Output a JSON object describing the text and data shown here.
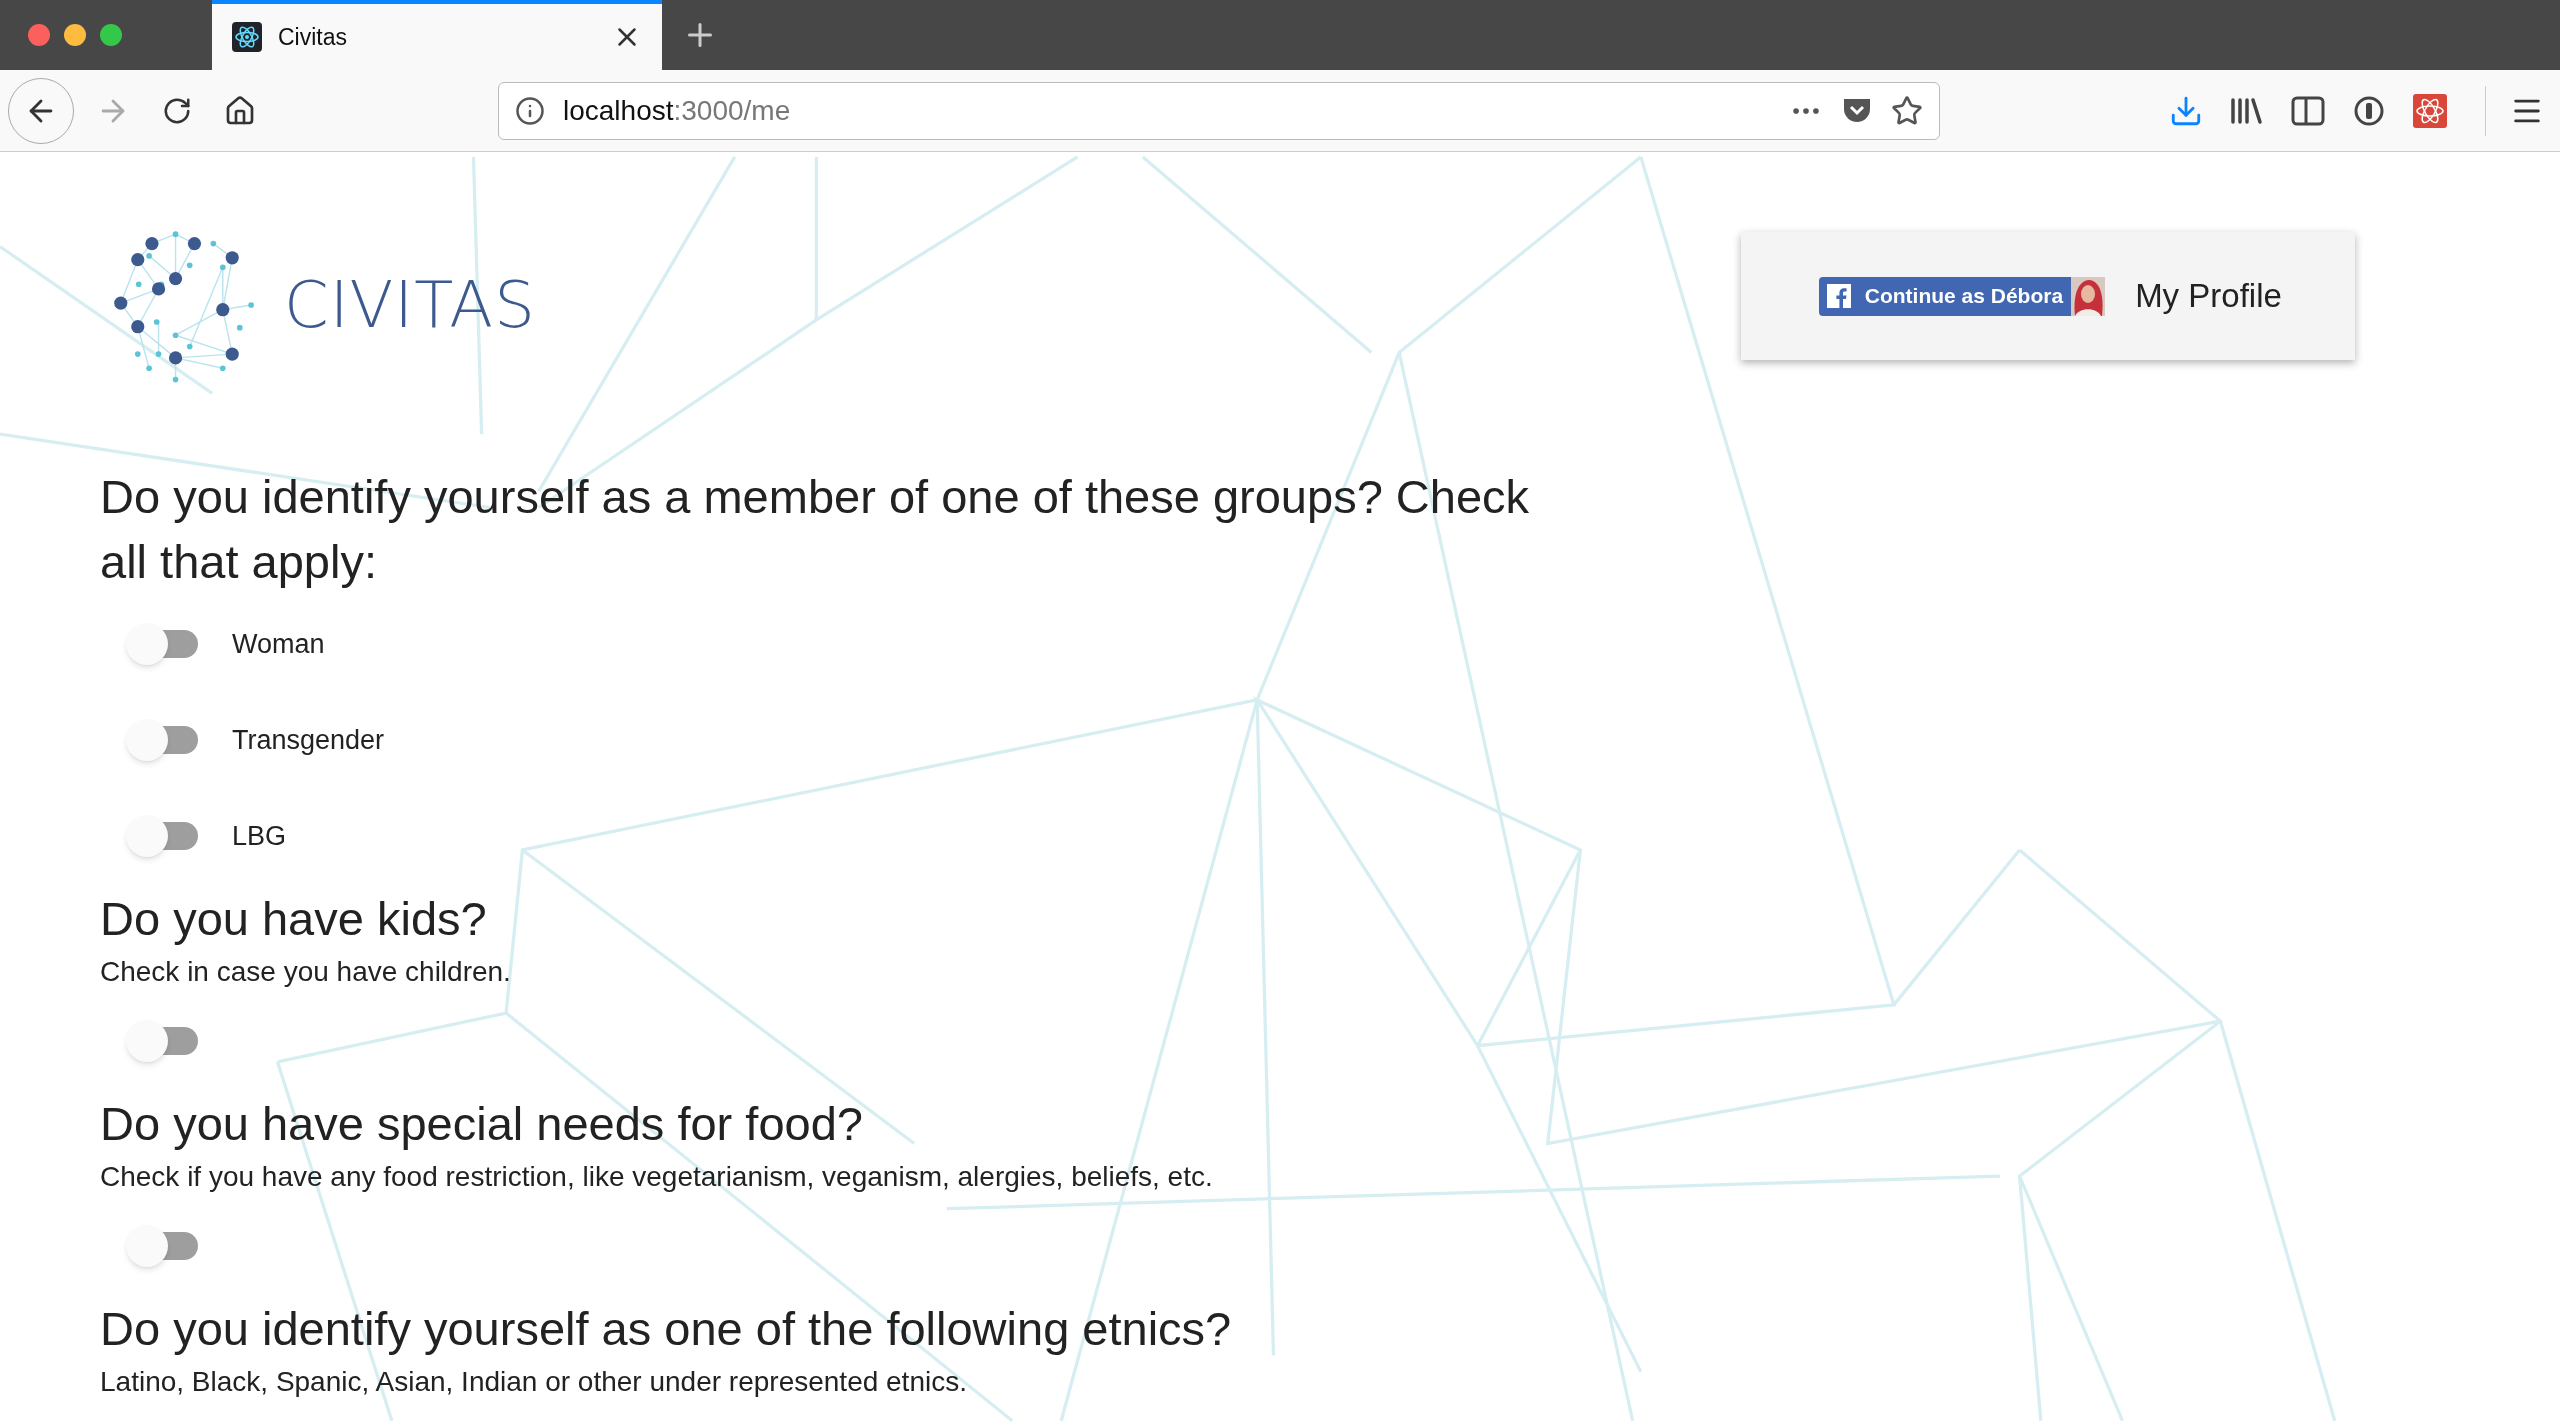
{
  "browser": {
    "tabs": [
      {
        "title": "Civitas",
        "selected": true
      }
    ],
    "url": {
      "host": "localhost",
      "path": ":3000/me"
    }
  },
  "header": {
    "logo": "CIVITAS",
    "profile": {
      "facebook_button": "Continue as Débora",
      "link": "My Profile"
    }
  },
  "sections": [
    {
      "title": "Do you identify yourself as a member of one of these groups? Check all that apply:",
      "options": [
        {
          "label": "Woman",
          "on": false
        },
        {
          "label": "Transgender",
          "on": false
        },
        {
          "label": "LBG",
          "on": false
        }
      ]
    },
    {
      "title": "Do you have kids?",
      "description": "Check in case you have children.",
      "options": [
        {
          "on": false
        }
      ]
    },
    {
      "title": "Do you have special needs for food?",
      "description": "Check if you have any food restriction, like vegetarianism, veganism, alergies, beliefs, etc.",
      "options": [
        {
          "on": false
        }
      ]
    },
    {
      "title": "Do you identify yourself as one of the following etnics?",
      "description": "Latino, Black, Spanic, Asian, Indian or other under represented etnics."
    }
  ]
}
